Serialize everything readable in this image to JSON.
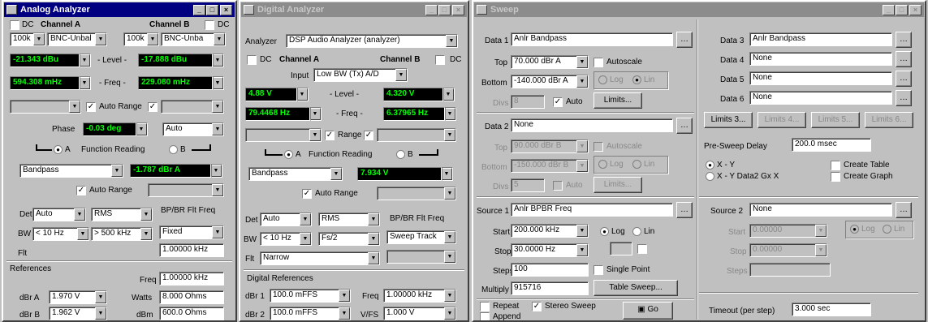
{
  "analog": {
    "title": "Analog Analyzer",
    "dc_a": "DC",
    "channel_a": "Channel A",
    "channel_b": "Channel B",
    "dc_b": "DC",
    "imp_a": "100k",
    "conn_a": "BNC-Unbal",
    "imp_b": "100k",
    "conn_b": "BNC-Unba",
    "level_a": "-21.343 dBu",
    "level_label": "- Level -",
    "level_b": "-17.888 dBu",
    "freq_a": "594.308 mHz",
    "freq_label": "- Freq -",
    "freq_b": "229.080 mHz",
    "auto_range": "Auto Range",
    "phase_label": "Phase",
    "phase_value": "-0.03 deg",
    "phase_unit": "Auto",
    "fr_a": "A",
    "fr_label": "Function Reading",
    "fr_b": "B",
    "function": "Bandpass",
    "function_value": "-1.787 dBr A",
    "auto_range2": "Auto Range",
    "det_label": "Det",
    "det": "Auto",
    "rms": "RMS",
    "bp_label": "BP/BR Flt Freq",
    "bw_label": "BW",
    "bw_lo": "< 10 Hz",
    "bw_hi": "> 500 kHz",
    "bp_mode": "Fixed",
    "bp_freq": "1.00000 kHz",
    "flt_label": "Flt",
    "refs_label": "References",
    "freq_ref_label": "Freq",
    "freq_ref": "1.00000 kHz",
    "dbra_label": "dBr A",
    "dbra": "1.970 V",
    "watts_label": "Watts",
    "watts": "8.000 Ohms",
    "dbrb_label": "dBr B",
    "dbrb": "1.962 V",
    "dbm_label": "dBm",
    "dbm": "600.0 Ohms"
  },
  "digital": {
    "title": "Digital Analyzer",
    "analyzer_label": "Analyzer",
    "analyzer": "DSP Audio Analyzer (analyzer)",
    "dc_a": "DC",
    "channel_a": "Channel A",
    "channel_b": "Channel B",
    "dc_b": "DC",
    "input_label": "Input",
    "input": "Low BW (Tx) A/D",
    "level_a": "4.88 V",
    "level_label": "- Level -",
    "level_b": "4.320 V",
    "freq_a": "79.4468 Hz",
    "freq_label": "- Freq -",
    "freq_b": "6.37965 Hz",
    "range": "Range",
    "fr_a": "A",
    "fr_label": "Function Reading",
    "fr_b": "B",
    "function": "Bandpass",
    "function_value": "7.934 V",
    "auto_range": "Auto Range",
    "det_label": "Det",
    "det": "Auto",
    "rms": "RMS",
    "bp_label": "BP/BR Flt Freq",
    "bw_label": "BW",
    "bw_lo": "< 10 Hz",
    "bw_hi": "Fs/2",
    "bp_mode": "Sweep Track",
    "flt_label": "Flt",
    "flt": "Narrow",
    "refs_label": "Digital References",
    "dbr1_label": "dBr 1",
    "dbr1": "100.0 mFFS",
    "freq_label2": "Freq",
    "freq_ref": "1.00000 kHz",
    "dbr2_label": "dBr 2",
    "dbr2": "100.0 mFFS",
    "vfs_label": "V/FS",
    "vfs": "1.000 V"
  },
  "sweep": {
    "title": "Sweep",
    "data1_label": "Data 1",
    "data1": "Anlr Bandpass",
    "top_label": "Top",
    "top": "70.000 dBr A",
    "autoscale": "Autoscale",
    "bottom_label": "Bottom",
    "bottom": "-140.000 dBr A",
    "log": "Log",
    "lin": "Lin",
    "div_label": "Divs",
    "div": "8",
    "auto": "Auto",
    "limits": "Limits...",
    "data2_label": "Data 2",
    "data2": "None",
    "top2": "90.000 dBr B",
    "autoscale2": "Autoscale",
    "bottom2": "-150.000 dBr B",
    "div2": "5",
    "auto2": "Auto",
    "limits2": "Limits...",
    "source1_label": "Source 1",
    "source1": "Anlr BPBR Freq",
    "start_label": "Start",
    "start": "200.000 kHz",
    "stop_label": "Stop",
    "stop": "30.0000 Hz",
    "steps_label": "Steps",
    "steps": "100",
    "single_point": "Single Point",
    "multiply_label": "Multiply",
    "multiply": "915716",
    "table_sweep": "Table Sweep...",
    "repeat": "Repeat",
    "stereo": "Stereo Sweep",
    "append": "Append",
    "go": "Go",
    "data3_label": "Data 3",
    "data3": "Anlr Bandpass",
    "data4_label": "Data 4",
    "data4": "None",
    "data5_label": "Data 5",
    "data5": "None",
    "data6_label": "Data 6",
    "data6": "None",
    "limits3": "Limits 3...",
    "limits4": "Limits 4...",
    "limits5": "Limits 5...",
    "limits6": "Limits 6...",
    "pre_delay_label": "Pre-Sweep Delay",
    "pre_delay": "200.0 msec",
    "xy": "X - Y",
    "xy2": "X - Y  Data2 Gx X",
    "create_table": "Create Table",
    "create_graph": "Create Graph",
    "source2_label": "Source 2",
    "source2": "None",
    "start2": "0.00000",
    "stop2": "0.00000",
    "steps2": "",
    "timeout_label": "Timeout (per step)",
    "timeout": "3.000 sec"
  }
}
